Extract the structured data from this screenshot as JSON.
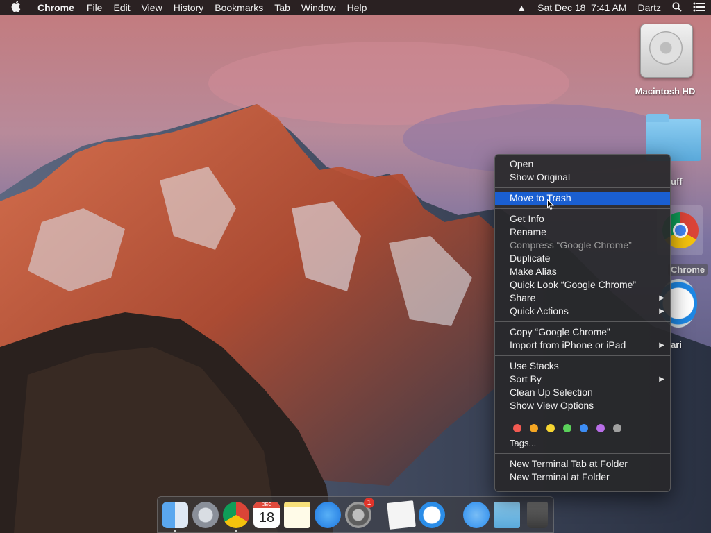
{
  "menubar": {
    "apple_icon": "apple-logo",
    "app_name": "Chrome",
    "menus": [
      "File",
      "Edit",
      "View",
      "History",
      "Bookmarks",
      "Tab",
      "Window",
      "Help"
    ],
    "status": {
      "eject_icon": "▲",
      "datetime": "Sat Dec 18  7:41 AM",
      "user": "Dartz",
      "search_icon": "search-icon",
      "notification_icon": "list-icon"
    }
  },
  "desktop_icons": {
    "macintosh_hd": "Macintosh HD",
    "folder_partial": "uff",
    "chrome": "Chrome",
    "safari_partial": "ari"
  },
  "context_menu": {
    "groups": [
      [
        {
          "label": "Open",
          "disabled": false
        },
        {
          "label": "Show Original",
          "disabled": false
        }
      ],
      [
        {
          "label": "Move to Trash",
          "disabled": false,
          "highlighted": true
        }
      ],
      [
        {
          "label": "Get Info",
          "disabled": false
        },
        {
          "label": "Rename",
          "disabled": false
        },
        {
          "label": "Compress “Google Chrome”",
          "disabled": true
        },
        {
          "label": "Duplicate",
          "disabled": false
        },
        {
          "label": "Make Alias",
          "disabled": false
        },
        {
          "label": "Quick Look “Google Chrome”",
          "disabled": false
        },
        {
          "label": "Share",
          "disabled": false,
          "submenu": true
        },
        {
          "label": "Quick Actions",
          "disabled": false,
          "submenu": true
        }
      ],
      [
        {
          "label": "Copy “Google Chrome”",
          "disabled": false
        },
        {
          "label": "Import from iPhone or iPad",
          "disabled": false,
          "submenu": true
        }
      ],
      [
        {
          "label": "Use Stacks",
          "disabled": false
        },
        {
          "label": "Sort By",
          "disabled": false,
          "submenu": true
        },
        {
          "label": "Clean Up Selection",
          "disabled": false
        },
        {
          "label": "Show View Options",
          "disabled": false
        }
      ]
    ],
    "tags": {
      "colors": [
        "#f25a52",
        "#f5a623",
        "#f7d631",
        "#5ad15a",
        "#3d8df5",
        "#b96ee8",
        "#a0a0a0"
      ],
      "label": "Tags..."
    },
    "terminal": [
      {
        "label": "New Terminal Tab at Folder",
        "disabled": false
      },
      {
        "label": "New Terminal at Folder",
        "disabled": false
      }
    ]
  },
  "dock": {
    "items": [
      {
        "name": "finder-icon",
        "color": "#3d8ee6",
        "running": true
      },
      {
        "name": "launchpad-icon",
        "color": "#8a8f99",
        "running": false
      },
      {
        "name": "chrome-icon",
        "color": "#e8e8e8",
        "running": true
      },
      {
        "name": "calendar-icon",
        "color": "#ffffff",
        "running": false,
        "text": "18",
        "month": "DEC"
      },
      {
        "name": "notes-icon",
        "color": "#f7e07a",
        "running": false
      },
      {
        "name": "app-store-icon",
        "color": "#2a8cf0",
        "running": false
      },
      {
        "name": "system-preferences-icon",
        "color": "#7a7a7a",
        "running": false,
        "badge": "1"
      },
      {
        "name": "textedit-icon",
        "color": "#f2f2f2",
        "running": false
      },
      {
        "name": "safari-icon",
        "color": "#2b8de8",
        "running": false
      },
      {
        "name": "applications-folder-icon",
        "color": "#2a8cf0",
        "running": false
      },
      {
        "name": "downloads-folder-icon",
        "color": "#6fb6e6",
        "running": false
      },
      {
        "name": "trash-icon",
        "color": "#5a5a5a",
        "running": false
      }
    ]
  }
}
